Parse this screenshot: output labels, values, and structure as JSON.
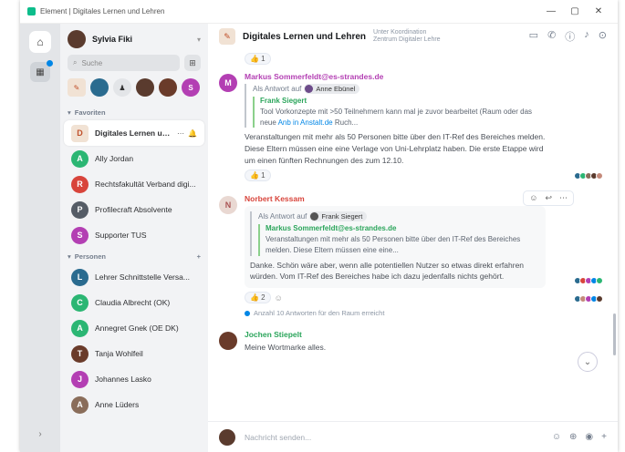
{
  "window": {
    "title": "Element | Digitales Lernen und Lehren",
    "controls": [
      "—",
      "▢",
      "✕"
    ]
  },
  "spacebar": {
    "home_icon": "home-icon",
    "expand_icon": "chevron-right-icon"
  },
  "user": {
    "name": "Sylvia Fiki"
  },
  "search": {
    "placeholder": "Suche"
  },
  "sections": {
    "favorites": "Favoriten",
    "people": "Personen"
  },
  "rooms": [
    {
      "name": "Digitales Lernen und L...",
      "color": "#f1e2d4",
      "initial": "D",
      "active": true
    },
    {
      "name": "Ally Jordan",
      "color": "#2bb673",
      "initial": "A",
      "active": false
    },
    {
      "name": "Rechtsfakultät Verband digi...",
      "color": "#d8443b",
      "initial": "R",
      "active": false
    },
    {
      "name": "Profilecraft Absolvente",
      "color": "#555c66",
      "initial": "P",
      "active": false
    },
    {
      "name": "Supporter TUS",
      "color": "#b33fb3",
      "initial": "S",
      "active": false
    }
  ],
  "people": [
    {
      "name": "Lehrer Schnittstelle Versa...",
      "color": "#2a6b8f",
      "initial": "L"
    },
    {
      "name": "Claudia Albrecht (OK)",
      "color": "#2bb673",
      "initial": "C"
    },
    {
      "name": "Annegret Gnek (OE DK)",
      "color": "#2bb673",
      "initial": "A"
    },
    {
      "name": "Tanja Wohlfeil",
      "color": "#6a3b2a",
      "initial": "T"
    },
    {
      "name": "Johannes Lasko",
      "color": "#b33fb3",
      "initial": "J"
    },
    {
      "name": "Anne Lüders",
      "color": "#8a6d5a",
      "initial": "A"
    }
  ],
  "room_header": {
    "title": "Digitales Lernen und Lehren",
    "topic": "Unter Koordination Zentrum Digitaler Lehre"
  },
  "events": [
    {
      "sender": "Markus Sommerfeldt@es-strandes.de",
      "reply_prefix": "Als Antwort auf",
      "reply_to": "Anne Ebünel",
      "quote_sender": "Frank Siegert",
      "quote_text": "Tool Vorkonzepte mit >50 Teilnehmern kann mal je zuvor bearbeitet (Raum oder das neue",
      "quote_link": "Anb in Anstalt.de",
      "quote_tail": "Ruch...",
      "body": "Veranstaltungen mit mehr als 50 Personen bitte über den IT-Ref des Bereiches melden. Diese Eltern müssen eine eine Verlage von Uni-Lehrplatz haben. Die erste Etappe wird um einen fünften Rechnungen des zum 12.10.",
      "reaction": "👍 1"
    },
    {
      "sender": "Norbert Kessam",
      "reply_prefix": "Als Antwort auf",
      "reply_to": "Frank Siegert",
      "quote_sender": "Markus Sommerfeldt@es-strandes.de",
      "quote_text": "Veranstaltungen mit mehr als 50 Personen bitte über den IT-Ref des Bereiches melden. Diese Eltern müssen eine eine...",
      "body": "Danke. Schön wäre aber, wenn alle potentiellen Nutzer so etwas direkt erfahren würden. Vom IT-Ref des Bereiches habe ich dazu jedenfalls nichts gehört.",
      "reaction": "👍 2",
      "thread": "Anzahl 10 Antworten für den Raum erreicht"
    },
    {
      "sender": "Jochen Stiepelt",
      "body": "Meine Wortmarke alles."
    }
  ],
  "composer": {
    "placeholder": "Nachricht senden..."
  },
  "colors": {
    "accent": "#0dbd8b",
    "link": "#0086e6",
    "sender_purple": "#b33fb3",
    "sender_red": "#d8443b",
    "sender_green": "#2ba55b"
  }
}
